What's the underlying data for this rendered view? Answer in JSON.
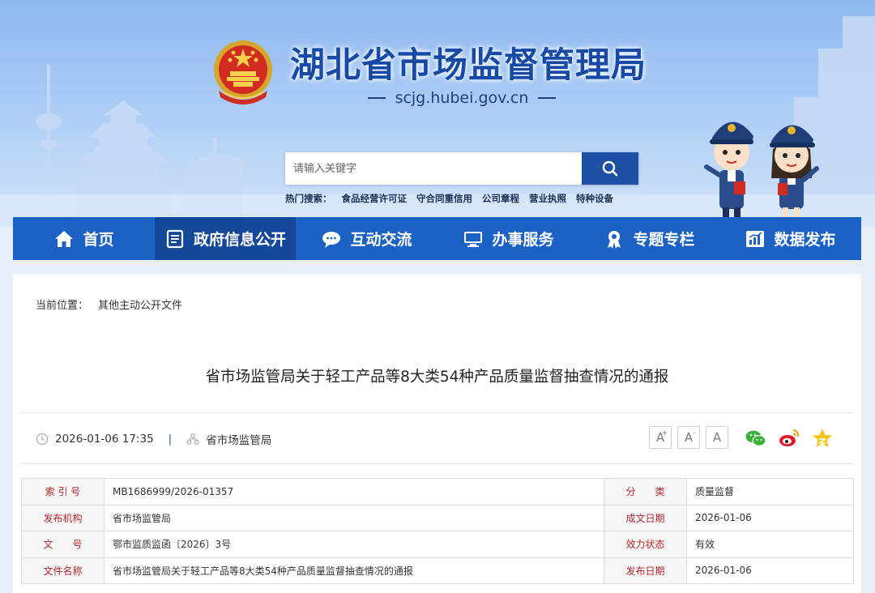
{
  "header": {
    "site_title": "湖北省市场监督管理局",
    "domain": "scjg.hubei.gov.cn",
    "search_placeholder": "请输入关键字",
    "hot_label": "热门搜索：",
    "hot_links": [
      "食品经营许可证",
      "守合同重信用",
      "公司章程",
      "营业执照",
      "特种设备"
    ]
  },
  "nav": {
    "items": [
      {
        "label": "首页",
        "icon": "home-icon"
      },
      {
        "label": "政府信息公开",
        "icon": "document-list-icon"
      },
      {
        "label": "互动交流",
        "icon": "chat-bubble-icon"
      },
      {
        "label": "办事服务",
        "icon": "monitor-icon"
      },
      {
        "label": "专题专栏",
        "icon": "award-icon"
      },
      {
        "label": "数据发布",
        "icon": "bar-chart-icon"
      }
    ],
    "active_index": 1
  },
  "breadcrumb": {
    "label": "当前位置：",
    "current": "其他主动公开文件"
  },
  "article": {
    "title": "省市场监管局关于轻工产品等8大类54种产品质量监督抽查情况的通报",
    "datetime": "2026-01-06 17:35",
    "separator": "|",
    "source": "省市场监管局",
    "font_buttons": [
      "A",
      "A",
      "A"
    ],
    "font_button_marks": [
      "+",
      "-",
      ""
    ]
  },
  "info_table": {
    "rows": [
      {
        "l1": "索 引 号",
        "v1": "MB1686999/2026-01357",
        "l2": "分　　类",
        "v2": "质量监督"
      },
      {
        "l1": "发布机构",
        "v1": "省市场监管局",
        "l2": "成文日期",
        "v2": "2026-01-06"
      },
      {
        "l1": "文　　号",
        "v1": "鄂市监质监函〔2026〕3号",
        "l2": "效力状态",
        "v2": "有效"
      },
      {
        "l1": "文件名称",
        "v1": "省市场监管局关于轻工产品等8大类54种产品质量监督抽查情况的通报",
        "l2": "发布日期",
        "v2": "2026-01-06"
      }
    ]
  },
  "colors": {
    "nav_bg": "#1c61c4",
    "nav_active": "#16489a",
    "title_blue": "#1749a6",
    "label_red": "#b3262a"
  }
}
